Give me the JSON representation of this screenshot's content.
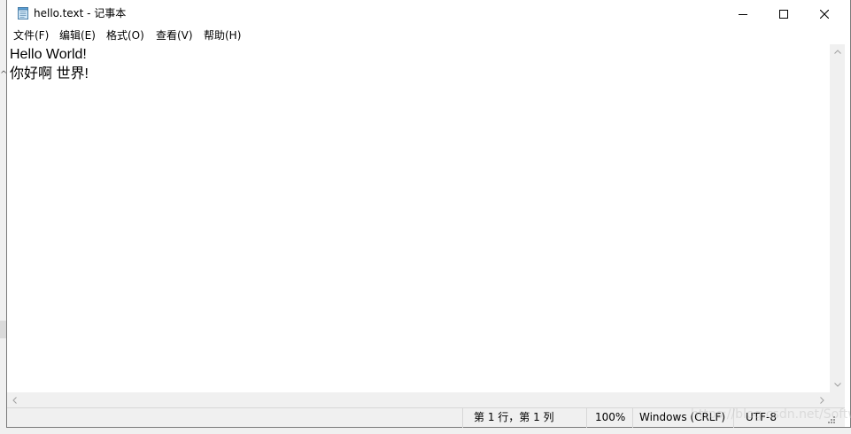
{
  "window": {
    "title": "hello.text - 记事本",
    "icon": "notepad-icon",
    "controls": [
      "minimize-icon",
      "maximize-icon",
      "close-icon"
    ]
  },
  "menu": [
    "文件(F)",
    "编辑(E)",
    "格式(O)",
    "查看(V)",
    "帮助(H)"
  ],
  "editor": {
    "lines": [
      "Hello World!",
      "你好啊 世界!"
    ]
  },
  "statusbar": {
    "position": "第 1 行，第 1 列",
    "zoom": "100%",
    "line_ending": "Windows (CRLF)",
    "encoding": "UTF-8"
  },
  "background": {
    "left_edge_glyph": "^"
  },
  "watermark": "https://blog.csdn.net/SoftwareCycesl",
  "colors": {
    "window_bg": "#ffffff",
    "chrome_bg": "#f0f0f0",
    "border": "#7a7a7a",
    "text": "#000000"
  }
}
